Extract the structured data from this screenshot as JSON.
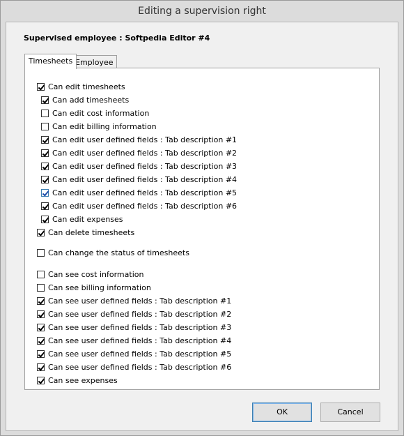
{
  "window": {
    "title": "Editing a supervision right"
  },
  "header": {
    "supervised_label": "Supervised employee : Softpedia Editor #4"
  },
  "tabs": [
    {
      "label": "Timesheets",
      "active": true
    },
    {
      "label": "Employee",
      "active": false
    }
  ],
  "checkboxes": [
    {
      "label": "Can edit timesheets",
      "checked": true
    },
    {
      "label": "Can add timesheets",
      "checked": true
    },
    {
      "label": "Can edit cost information",
      "checked": false
    },
    {
      "label": "Can edit billing information",
      "checked": false
    },
    {
      "label": "Can edit user defined fields : Tab description #1",
      "checked": true
    },
    {
      "label": "Can edit user defined fields : Tab description #2",
      "checked": true
    },
    {
      "label": "Can edit user defined fields : Tab description #3",
      "checked": true
    },
    {
      "label": "Can edit user defined fields : Tab description #4",
      "checked": true
    },
    {
      "label": "Can edit user defined fields : Tab description #5",
      "checked": true
    },
    {
      "label": "Can edit user defined fields : Tab description #6",
      "checked": true
    },
    {
      "label": "Can edit expenses",
      "checked": true
    },
    {
      "label": "Can delete timesheets",
      "checked": true
    },
    {
      "label": "Can change the status of timesheets",
      "checked": false
    },
    {
      "label": "Can see cost information",
      "checked": false
    },
    {
      "label": "Can see billing information",
      "checked": false
    },
    {
      "label": "Can see user defined fields : Tab description #1",
      "checked": true
    },
    {
      "label": "Can see user defined fields : Tab description #2",
      "checked": true
    },
    {
      "label": "Can see user defined fields : Tab description #3",
      "checked": true
    },
    {
      "label": "Can see user defined fields : Tab description #4",
      "checked": true
    },
    {
      "label": "Can see user defined fields : Tab description #5",
      "checked": true
    },
    {
      "label": "Can see user defined fields : Tab description #6",
      "checked": true
    },
    {
      "label": "Can see expenses",
      "checked": true
    }
  ],
  "buttons": {
    "ok": "OK",
    "cancel": "Cancel"
  }
}
